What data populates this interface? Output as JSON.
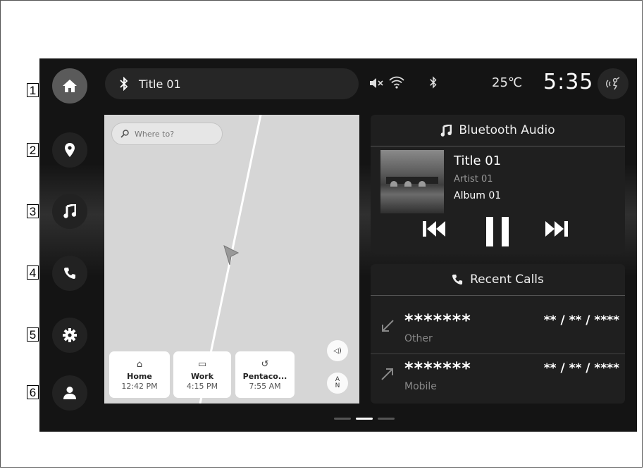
{
  "callouts": [
    "1",
    "2",
    "3",
    "4",
    "5",
    "6"
  ],
  "rail": {
    "items": [
      {
        "name": "home",
        "icon": "home-icon"
      },
      {
        "name": "navigation",
        "icon": "location-pin-icon"
      },
      {
        "name": "music",
        "icon": "music-note-icon"
      },
      {
        "name": "phone",
        "icon": "phone-icon"
      },
      {
        "name": "settings",
        "icon": "gear-icon"
      },
      {
        "name": "profile",
        "icon": "person-icon"
      }
    ]
  },
  "status": {
    "media_title": "Title 01",
    "temperature": "25℃",
    "clock": "5:35",
    "icons": [
      "bluetooth-icon",
      "mute-icon",
      "wifi-icon",
      "bluetooth-icon",
      "voice-assistant-icon"
    ]
  },
  "map": {
    "search_placeholder": "Where to?",
    "destinations": [
      {
        "icon": "⌂",
        "name": "Home",
        "time": "12:42 PM"
      },
      {
        "icon": "▭",
        "name": "Work",
        "time": "4:15 PM"
      },
      {
        "icon": "↺",
        "name": "Pentaco...",
        "time": "7:55 AM"
      }
    ],
    "volume_glyph": "◁)",
    "north_glyph": "A N"
  },
  "audio": {
    "header": "Bluetooth Audio",
    "track_title": "Title 01",
    "artist": "Artist 01",
    "album": "Album 01"
  },
  "calls": {
    "header": "Recent Calls",
    "items": [
      {
        "number": "*******",
        "type": "Other",
        "date": "** / ** / ****",
        "direction": "incoming"
      },
      {
        "number": "*******",
        "type": "Mobile",
        "date": "** / ** / ****",
        "direction": "outgoing"
      }
    ]
  },
  "pager": {
    "pages": 3,
    "active": 2
  }
}
